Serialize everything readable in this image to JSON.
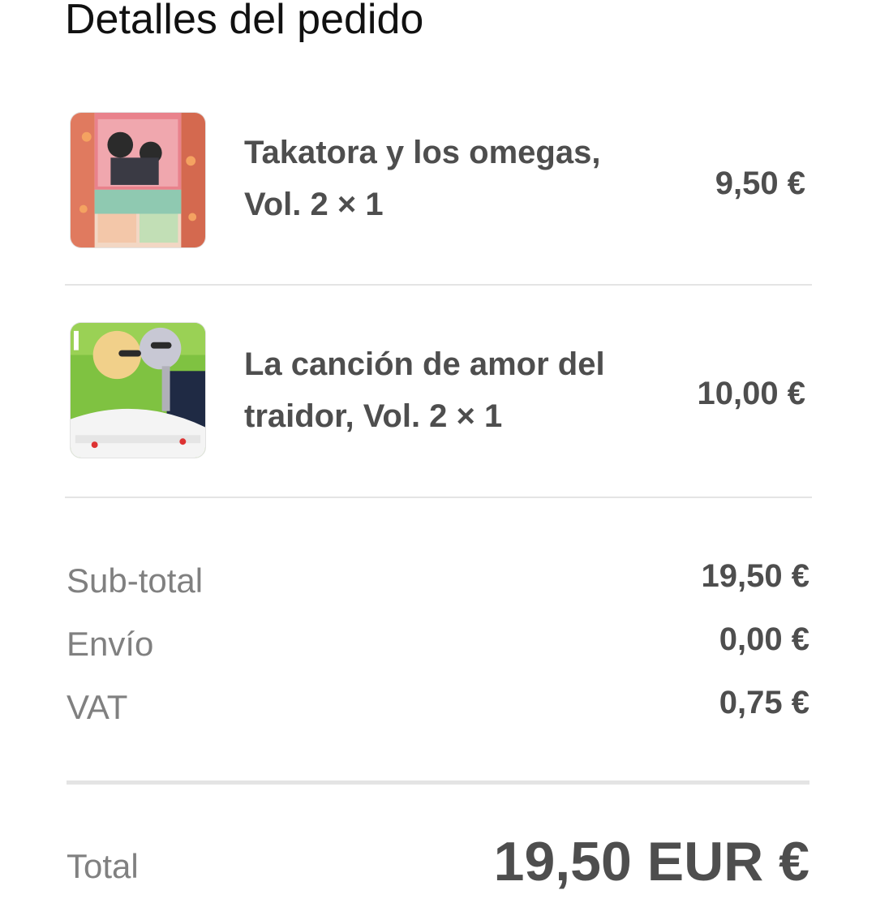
{
  "header": {
    "title": "Detalles del pedido"
  },
  "items": [
    {
      "name": "Takatora y los omegas, Vol. 2 × 1",
      "price": "9,50 €",
      "cover_icon": "book-cover-image"
    },
    {
      "name": "La canción de amor del traidor, Vol. 2 × 1",
      "price": "10,00 €",
      "cover_icon": "book-cover-image"
    }
  ],
  "summary": {
    "subtotal_label": "Sub-total",
    "subtotal_value": "19,50 €",
    "shipping_label": "Envío",
    "shipping_value": "0,00 €",
    "vat_label": "VAT",
    "vat_value": "0,75 €"
  },
  "total": {
    "label": "Total",
    "value": "19,50 EUR €"
  },
  "colors": {
    "text_dark": "#4e4e4e",
    "text_muted": "#808080",
    "divider": "#e4e4e4"
  }
}
